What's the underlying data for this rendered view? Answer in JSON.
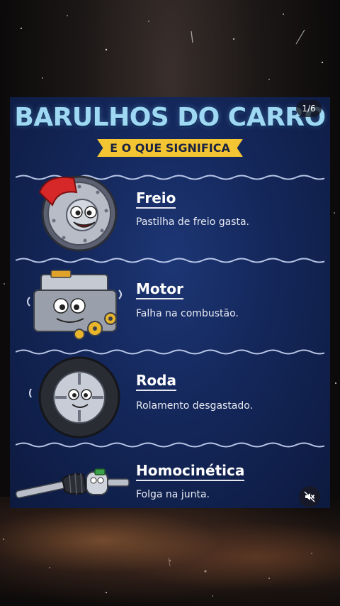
{
  "post": {
    "title": "BARULHOS DO CARRO",
    "subtitle": "E O QUE SIGNIFICA",
    "page_counter": "1/6",
    "items": [
      {
        "label": "Freio",
        "description": "Pastilha de freio gasta.",
        "icon": "brake-disc-icon"
      },
      {
        "label": "Motor",
        "description": "Falha na combustão.",
        "icon": "engine-icon"
      },
      {
        "label": "Roda",
        "description": "Rolamento desgastado.",
        "icon": "wheel-icon"
      },
      {
        "label": "Homocinética",
        "description": "Folga na junta.",
        "icon": "cv-joint-icon"
      }
    ]
  },
  "controls": {
    "mute_icon": "speaker-muted-icon"
  },
  "colors": {
    "title": "#9ed8f2",
    "ribbon": "#f3c533",
    "card_bg": "#14275a"
  }
}
